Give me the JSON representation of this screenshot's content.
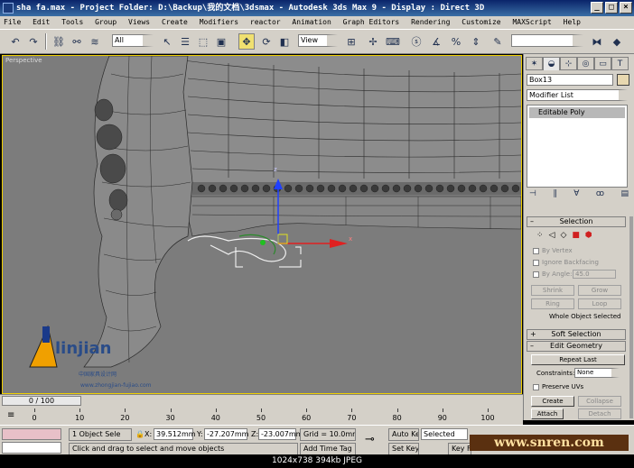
{
  "window": {
    "title": "sha fa.max    - Project Folder: D:\\Backup\\我的文档\\3dsmax    - Autodesk 3ds Max 9    - Display : Direct 3D",
    "buttons": [
      "_",
      "□",
      "×"
    ]
  },
  "menu": [
    "File",
    "Edit",
    "Tools",
    "Group",
    "Views",
    "Create",
    "Modifiers",
    "reactor",
    "Animation",
    "Graph Editors",
    "Rendering",
    "Customize",
    "MAXScript",
    "Help"
  ],
  "toolbar": {
    "selection_filter": "All",
    "coord_system": "View",
    "active_tool": "select-and-move"
  },
  "viewport": {
    "label": "Perspective",
    "logo_text": "linjian",
    "logo_caption": "www.zhongjian-fujiao.com",
    "logo_cn": "中国家具设计网"
  },
  "panel": {
    "object_name": "Box13",
    "modifier_list_label": "Modifier List",
    "stack_items": [
      "Editable Poly"
    ],
    "selection_title": "Selection",
    "by_vertex": "By Vertex",
    "ignore_backfacing": "Ignore Backfacing",
    "by_angle": "By Angle:",
    "by_angle_value": "45.0",
    "shrink": "Shrink",
    "grow": "Grow",
    "ring": "Ring",
    "loop": "Loop",
    "whole_object_selected": "Whole Object Selected",
    "soft_selection_title": "Soft Selection",
    "edit_geometry_title": "Edit Geometry",
    "repeat_last": "Repeat Last",
    "constraints_label": "Constraints:",
    "constraints_value": "None",
    "preserve_uvs": "Preserve UVs",
    "create": "Create",
    "collapse": "Collapse",
    "attach": "Attach",
    "detach": "Detach"
  },
  "timeline": {
    "frame_display": "0 / 100",
    "ticks": [
      "0",
      "10",
      "20",
      "30",
      "40",
      "50",
      "60",
      "70",
      "80",
      "90",
      "100"
    ]
  },
  "status": {
    "selection_count": "1 Object Sele",
    "x_label": "X:",
    "x_value": "39.512mm",
    "y_label": "Y:",
    "y_value": "-27.207mm",
    "z_label": "Z:",
    "z_value": "-23.007mm",
    "grid": "Grid = 10.0mm",
    "prompt": "Click and drag to select and move objects",
    "add_time_tag": "Add Time Tag",
    "auto_key": "Auto Key",
    "set_key": "Set Key",
    "key_mode_value": "Selected",
    "key_filters": "Key Filte"
  },
  "footer": "1024x738  394kb  JPEG",
  "watermark": "www.snren.com",
  "colors": {
    "viewport_bg": "#7c7c7c",
    "active_border": "#f0d000",
    "gizmo_z": "#2040ff",
    "gizmo_x": "#e02020",
    "gizmo_y": "#20c020"
  }
}
